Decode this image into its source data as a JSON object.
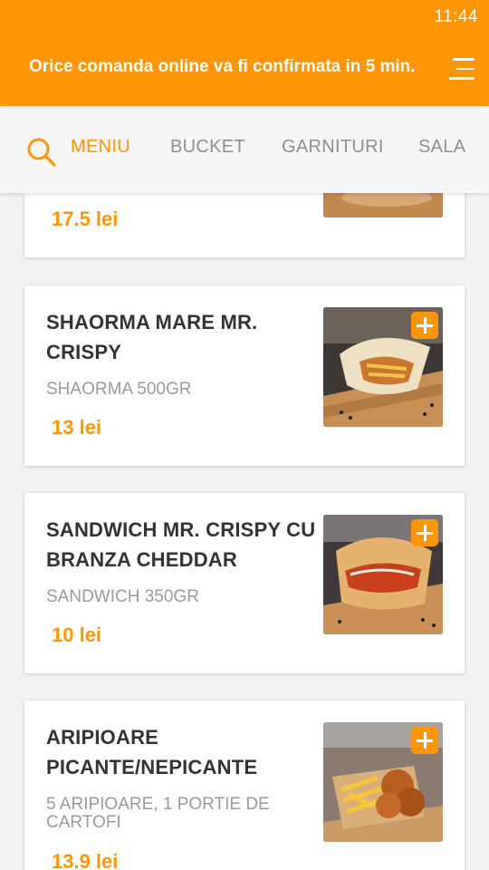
{
  "status_bar": {
    "time": "11:44"
  },
  "header": {
    "banner": "Orice comanda online va fi confirmata in 5 min."
  },
  "tabs": [
    {
      "label": "MENIU",
      "active": true
    },
    {
      "label": "BUCKET",
      "active": false
    },
    {
      "label": "GARNITURI",
      "active": false
    },
    {
      "label": "SALA",
      "active": false
    }
  ],
  "products": [
    {
      "name": "",
      "description": "",
      "price": "17.5 lei"
    },
    {
      "name": "SHAORMA MARE MR. CRISPY",
      "description": "SHAORMA 500GR",
      "price": "13 lei"
    },
    {
      "name": "SANDWICH MR. CRISPY CU BRANZA CHEDDAR",
      "description": "SANDWICH 350GR",
      "price": "10 lei"
    },
    {
      "name": "ARIPIOARE PICANTE/NEPICANTE",
      "description": "5 ARIPIOARE, 1 PORTIE DE CARTOFI",
      "price": "13.9 lei"
    }
  ],
  "colors": {
    "accent": "#ff9607",
    "title_text": "#333333",
    "muted_text": "#9a9a9a"
  }
}
